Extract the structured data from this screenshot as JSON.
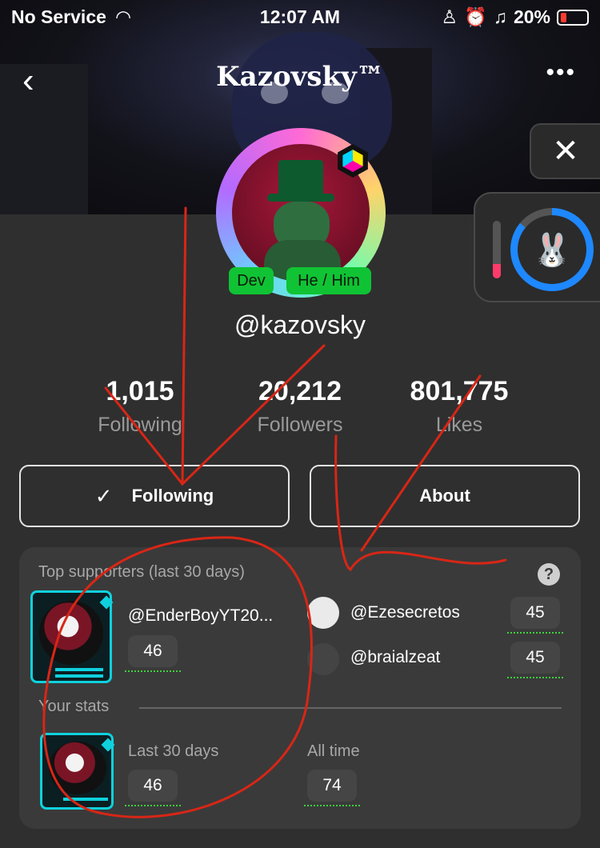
{
  "status_bar": {
    "carrier": "No Service",
    "time": "12:07 AM",
    "battery_percent": "20%"
  },
  "nav": {
    "back_icon": "‹",
    "title": "Kazovsky™",
    "more_icon": "•••"
  },
  "overlay": {
    "close_icon": "✕",
    "ring_progress": 0.86,
    "side_bar_level": 0.25
  },
  "profile": {
    "tags": [
      "Dev",
      "He / Him"
    ],
    "handle": "@kazovsky",
    "stats": [
      {
        "value": "1,015",
        "label": "Following"
      },
      {
        "value": "20,212",
        "label": "Followers"
      },
      {
        "value": "801,775",
        "label": "Likes"
      }
    ]
  },
  "actions": {
    "following_check": "✓",
    "following_label": "Following",
    "about_label": "About"
  },
  "supporters": {
    "title": "Top supporters (last 30 days)",
    "help_icon": "?",
    "top": {
      "name": "@EnderBoyYT20...",
      "count": "46"
    },
    "others": [
      {
        "name": "@Ezesecretos",
        "count": "45"
      },
      {
        "name": "@braialzeat",
        "count": "45"
      }
    ]
  },
  "your_stats": {
    "title": "Your stats",
    "last30_label": "Last 30 days",
    "last30_value": "46",
    "alltime_label": "All time",
    "alltime_value": "74"
  },
  "colors": {
    "background": "#2f2f2f",
    "tag_green": "#10c334",
    "frame_cyan": "#0fd1dd",
    "ring_blue": "#1e88ff",
    "annotation_red": "#d82616"
  }
}
